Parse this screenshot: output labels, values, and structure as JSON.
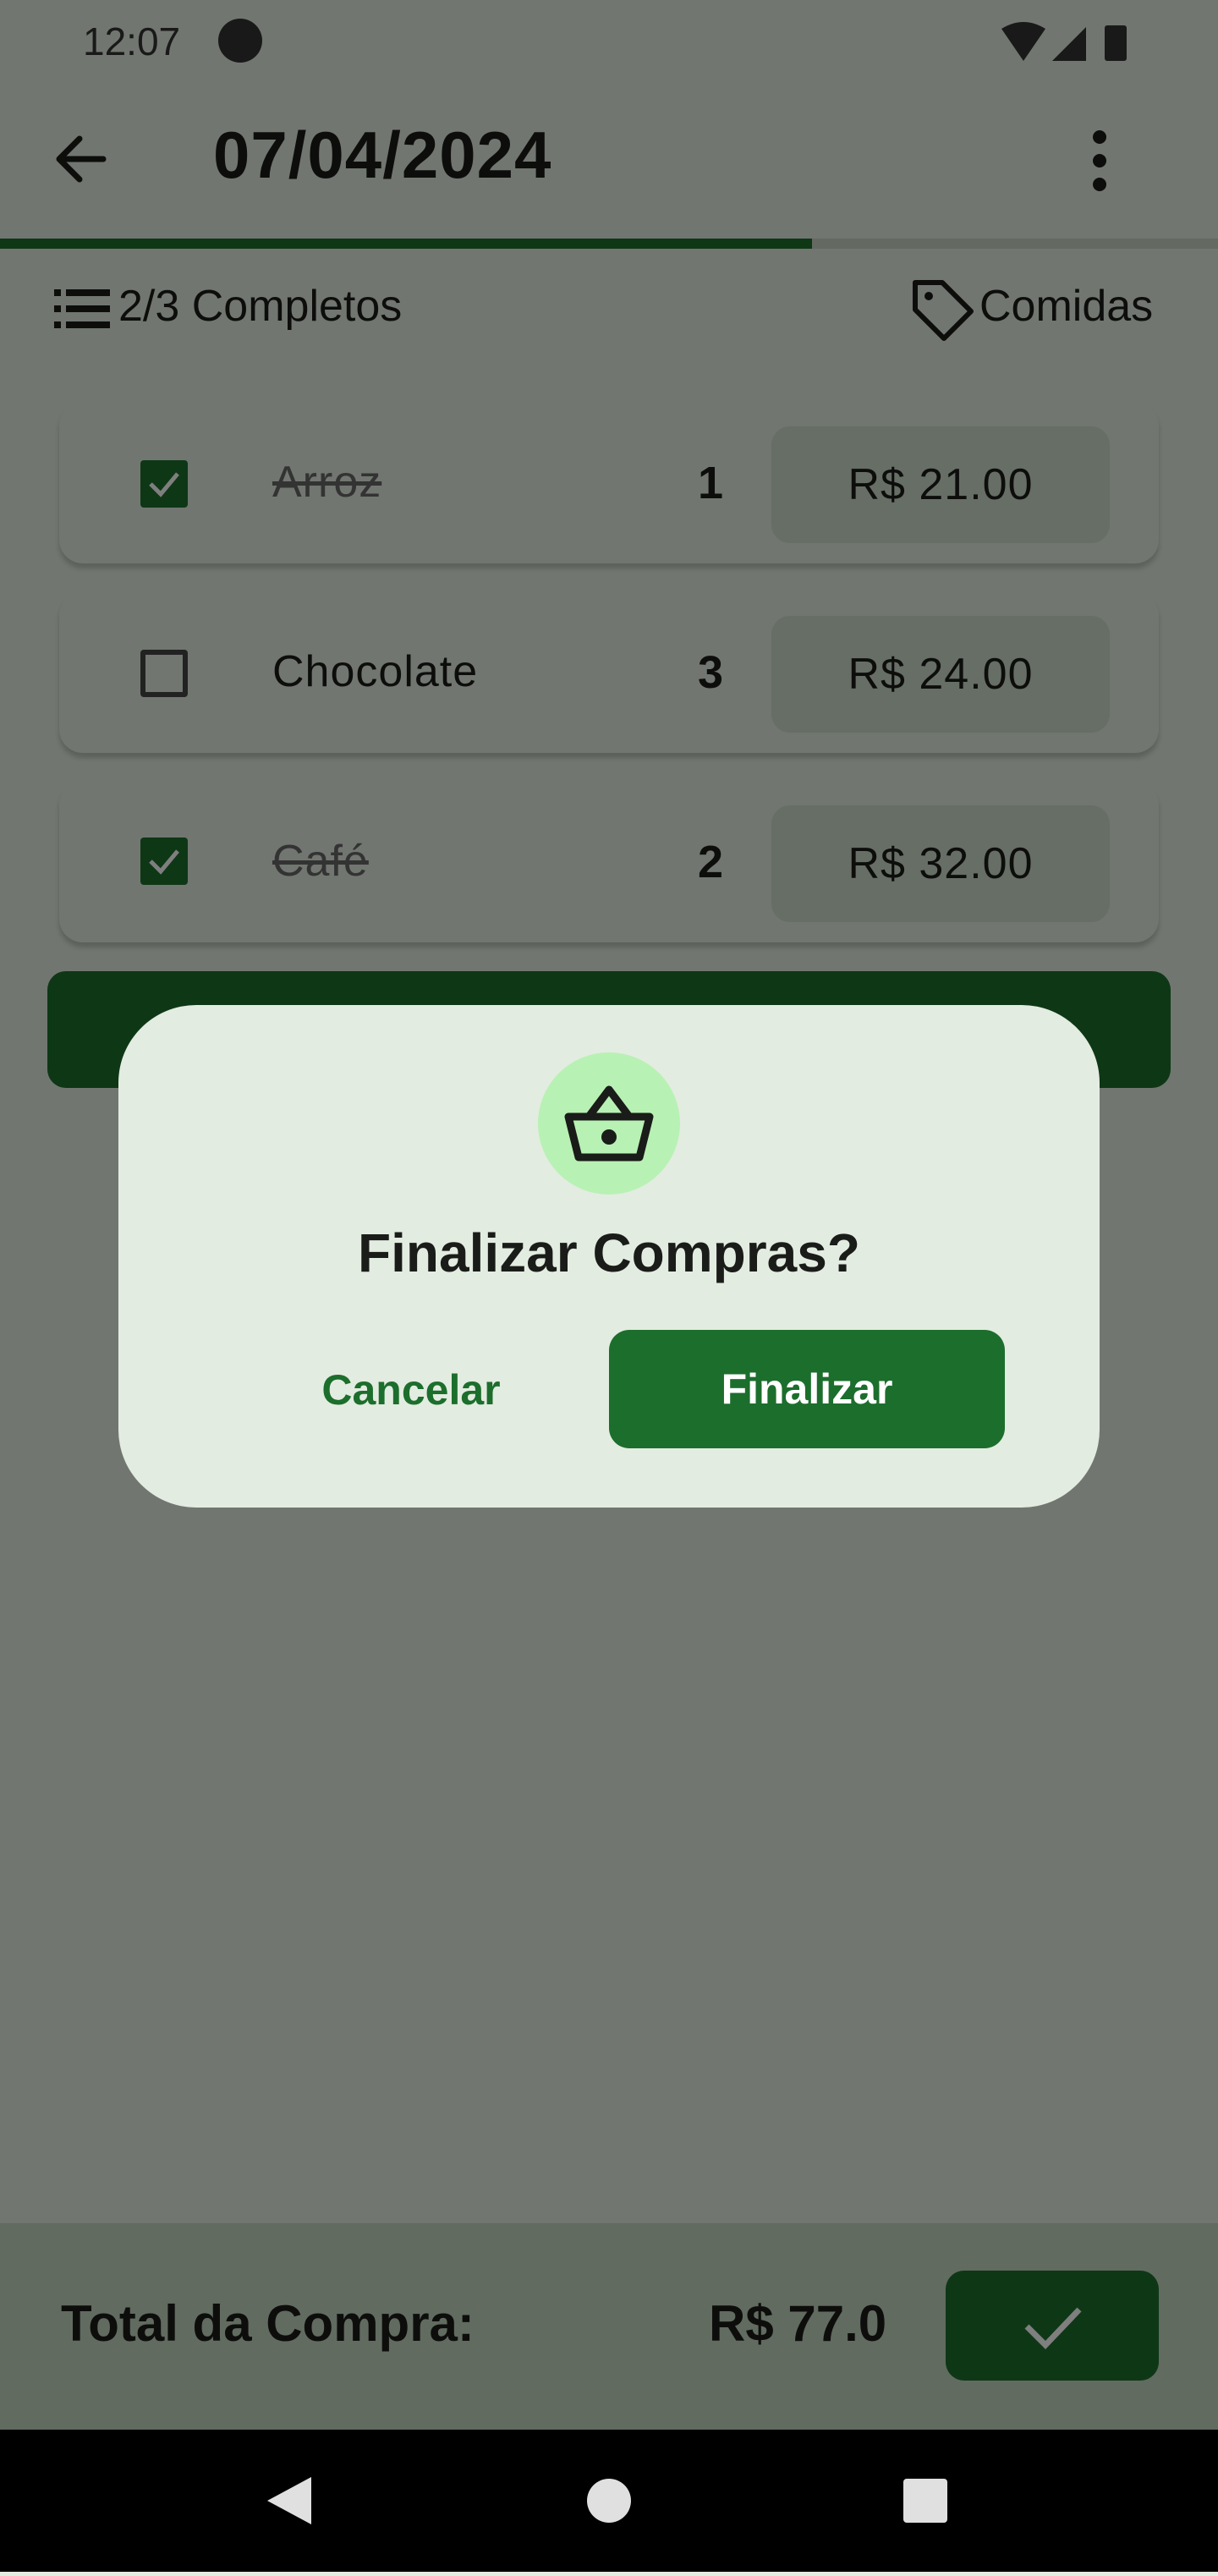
{
  "status_bar": {
    "time": "12:07"
  },
  "app_bar": {
    "title": "07/04/2024"
  },
  "progress": {
    "completed": 2,
    "total": 3,
    "fraction": 0.667
  },
  "summary": {
    "count_text": "2/3 Completos",
    "category": "Comidas"
  },
  "items": [
    {
      "name": "Arroz",
      "quantity": "1",
      "price": "R$ 21.00",
      "checked": true
    },
    {
      "name": "Chocolate",
      "quantity": "3",
      "price": "R$ 24.00",
      "checked": false
    },
    {
      "name": "Café",
      "quantity": "2",
      "price": "R$ 32.00",
      "checked": true
    }
  ],
  "footer": {
    "total_label": "Total da Compra:",
    "total_value": "R$ 77.0"
  },
  "dialog": {
    "title": "Finalizar Compras?",
    "cancel_label": "Cancelar",
    "confirm_label": "Finalizar",
    "icon": "shopping-basket-icon"
  },
  "colors": {
    "primary": "#1c6e2c",
    "surface": "#e3ece0",
    "icon_bg": "#b8f1b4"
  }
}
